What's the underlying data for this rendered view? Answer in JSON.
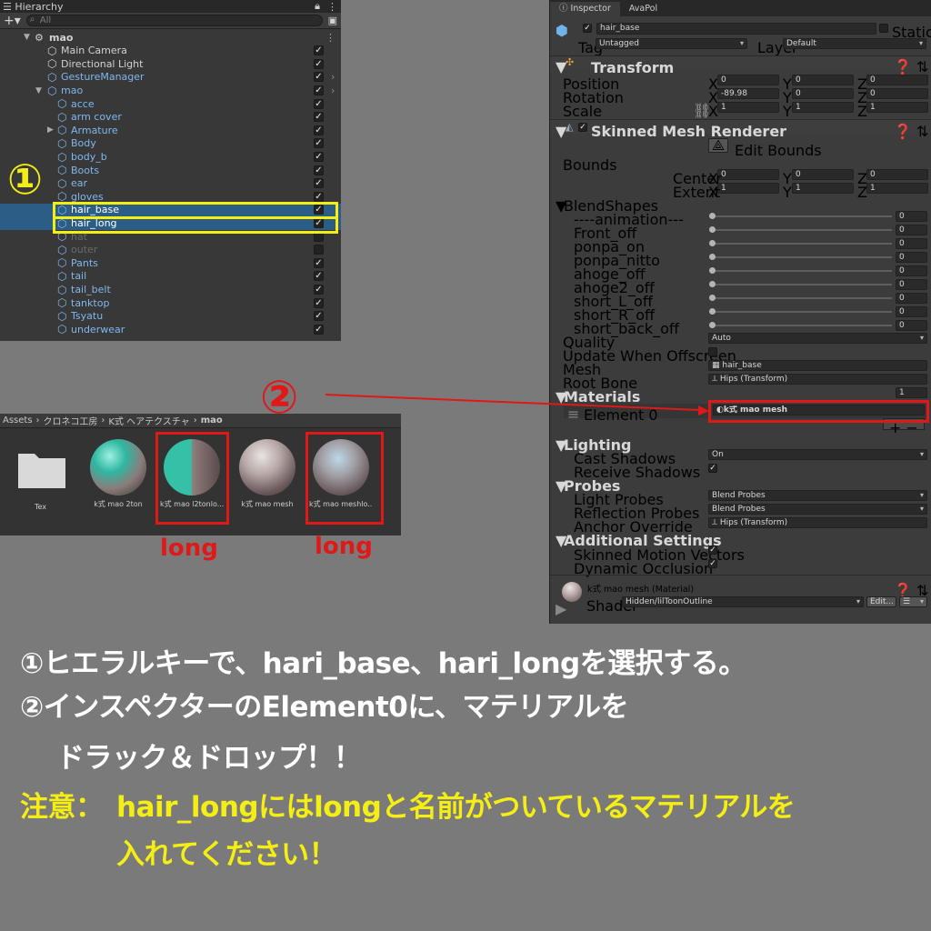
{
  "hierarchy": {
    "title": "Hierarchy",
    "search_placeholder": "All",
    "root": "mao",
    "items": [
      {
        "label": "Main Camera",
        "checked": true,
        "kind": "normal"
      },
      {
        "label": "Directional Light",
        "checked": true,
        "kind": "normal"
      },
      {
        "label": "GestureManager",
        "checked": true,
        "kind": "prefab"
      },
      {
        "label": "mao",
        "checked": true,
        "kind": "prefab"
      },
      {
        "label": "acce",
        "checked": true,
        "kind": "prefab"
      },
      {
        "label": "arm cover",
        "checked": true,
        "kind": "prefab"
      },
      {
        "label": "Armature",
        "checked": true,
        "kind": "prefab"
      },
      {
        "label": "Body",
        "checked": true,
        "kind": "prefab"
      },
      {
        "label": "body_b",
        "checked": true,
        "kind": "prefab"
      },
      {
        "label": "Boots",
        "checked": true,
        "kind": "prefab"
      },
      {
        "label": "ear",
        "checked": true,
        "kind": "prefab"
      },
      {
        "label": "gloves",
        "checked": true,
        "kind": "prefab"
      },
      {
        "label": "hair_base",
        "checked": true,
        "kind": "selected"
      },
      {
        "label": "hair_long",
        "checked": true,
        "kind": "selected"
      },
      {
        "label": "hat",
        "checked": false,
        "kind": "disabled"
      },
      {
        "label": "outer",
        "checked": false,
        "kind": "disabled"
      },
      {
        "label": "Pants",
        "checked": true,
        "kind": "prefab"
      },
      {
        "label": "tail",
        "checked": true,
        "kind": "prefab"
      },
      {
        "label": "tail_belt",
        "checked": true,
        "kind": "prefab"
      },
      {
        "label": "tanktop",
        "checked": true,
        "kind": "prefab"
      },
      {
        "label": "Tsyatu",
        "checked": true,
        "kind": "prefab"
      },
      {
        "label": "underwear",
        "checked": true,
        "kind": "prefab"
      }
    ]
  },
  "assets": {
    "breadcrumb": [
      "Assets",
      "クロネコ工房",
      "K式 ヘアテクスチャ",
      "mao"
    ],
    "folder_label": "Tex",
    "materials": [
      "k式 mao 2ton",
      "k式 mao l2tonlo...",
      "k式 mao mesh",
      "k式 mao meshlo..."
    ]
  },
  "inspector": {
    "tabs": [
      "Inspector",
      "AvaPol"
    ],
    "object_name": "hair_base",
    "static_label": "Static",
    "tag_label": "Tag",
    "tag_value": "Untagged",
    "layer_label": "Layer",
    "layer_value": "Default",
    "transform": {
      "title": "Transform",
      "position_label": "Position",
      "position": [
        "0",
        "0",
        "0"
      ],
      "rotation_label": "Rotation",
      "rotation": [
        "-89.98",
        "0",
        "0"
      ],
      "scale_label": "Scale",
      "scale": [
        "1",
        "1",
        "1"
      ]
    },
    "smr": {
      "title": "Skinned Mesh Renderer",
      "edit_bounds": "Edit Bounds",
      "bounds_label": "Bounds",
      "center_label": "Center",
      "center": [
        "0",
        "0",
        "0"
      ],
      "extent_label": "Extent",
      "extent": [
        "1",
        "1",
        "1"
      ],
      "blendshapes_label": "BlendShapes",
      "blendshapes": [
        {
          "name": "----animation---",
          "value": "0"
        },
        {
          "name": "Front_off",
          "value": "0"
        },
        {
          "name": "ponpa_on",
          "value": "0"
        },
        {
          "name": "ponpa_nitto",
          "value": "0"
        },
        {
          "name": "ahoge_off",
          "value": "0"
        },
        {
          "name": "ahoge2_off",
          "value": "0"
        },
        {
          "name": "short_L_off",
          "value": "0"
        },
        {
          "name": "short_R_off",
          "value": "0"
        },
        {
          "name": "short_back_off",
          "value": "0"
        }
      ],
      "quality_label": "Quality",
      "quality": "Auto",
      "update_offscreen_label": "Update When Offscreen",
      "mesh_label": "Mesh",
      "mesh": "hair_base",
      "root_bone_label": "Root Bone",
      "root_bone": "Hips (Transform)",
      "materials_label": "Materials",
      "materials_count": "1",
      "element0_label": "Element 0",
      "element0": "k式 mao mesh",
      "lighting_label": "Lighting",
      "cast_shadows_label": "Cast Shadows",
      "cast_shadows": "On",
      "receive_shadows_label": "Receive Shadows",
      "probes_label": "Probes",
      "light_probes_label": "Light Probes",
      "light_probes": "Blend Probes",
      "reflection_probes_label": "Reflection Probes",
      "reflection_probes": "Blend Probes",
      "anchor_label": "Anchor Override",
      "anchor": "Hips (Transform)",
      "additional_label": "Additional Settings",
      "skinned_motion_label": "Skinned Motion Vectors",
      "dynamic_occlusion_label": "Dynamic Occlusion"
    },
    "material": {
      "title": "k式 mao mesh (Material)",
      "shader_label": "Shader",
      "shader": "Hidden/lilToonOutline",
      "edit_label": "Edit..."
    }
  },
  "annotations": {
    "marker1": "①",
    "marker2": "②",
    "long1": "long",
    "long2": "long",
    "line1": "①ヒエラルキーで、hari_base、hari_longを選択する。",
    "line2": "②インスペクターのElement0に、マテリアルを",
    "line3": "ドラック＆ドロップ！！",
    "note_head": "注意：",
    "note1": "hair_longにはlongと名前がついているマテリアルを",
    "note2": "入れてください！"
  },
  "colors": {
    "selection": "#2c5d87",
    "highlight_red": "#e01818",
    "highlight_yellow": "#f4ef10",
    "prefab_blue": "#7fb7ef"
  }
}
